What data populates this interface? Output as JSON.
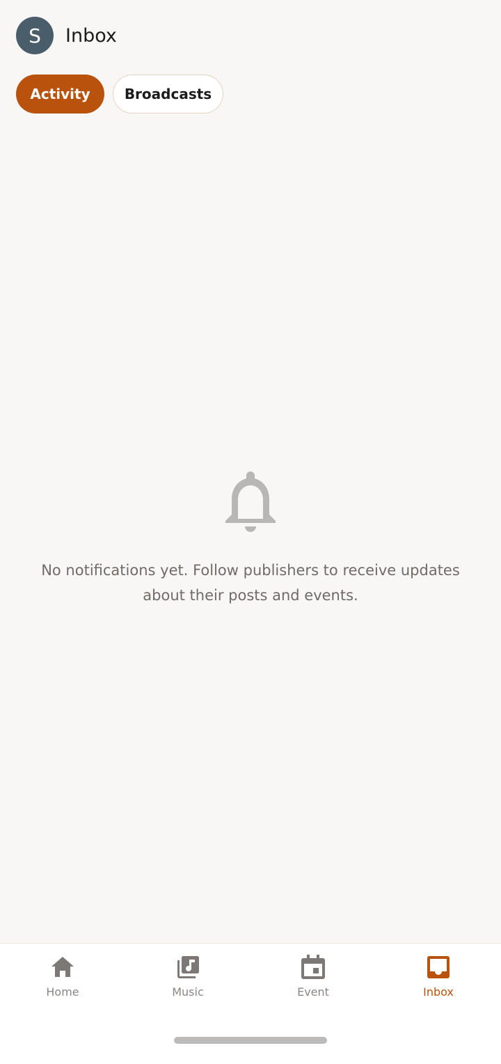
{
  "header": {
    "avatar_letter": "S",
    "title": "Inbox"
  },
  "tabs": [
    {
      "label": "Activity",
      "active": true
    },
    {
      "label": "Broadcasts",
      "active": false
    }
  ],
  "empty_state": {
    "icon": "bell-icon",
    "message": "No notifications yet. Follow publishers to receive updates about their posts and events."
  },
  "nav": [
    {
      "label": "Home",
      "icon": "home-icon",
      "active": false
    },
    {
      "label": "Music",
      "icon": "music-library-icon",
      "active": false
    },
    {
      "label": "Event",
      "icon": "calendar-icon",
      "active": false
    },
    {
      "label": "Inbox",
      "icon": "inbox-icon",
      "active": true
    }
  ],
  "colors": {
    "accent": "#b8520c",
    "background": "#f9f7f6",
    "avatar": "#4a5d6b",
    "muted": "#8a8684"
  }
}
